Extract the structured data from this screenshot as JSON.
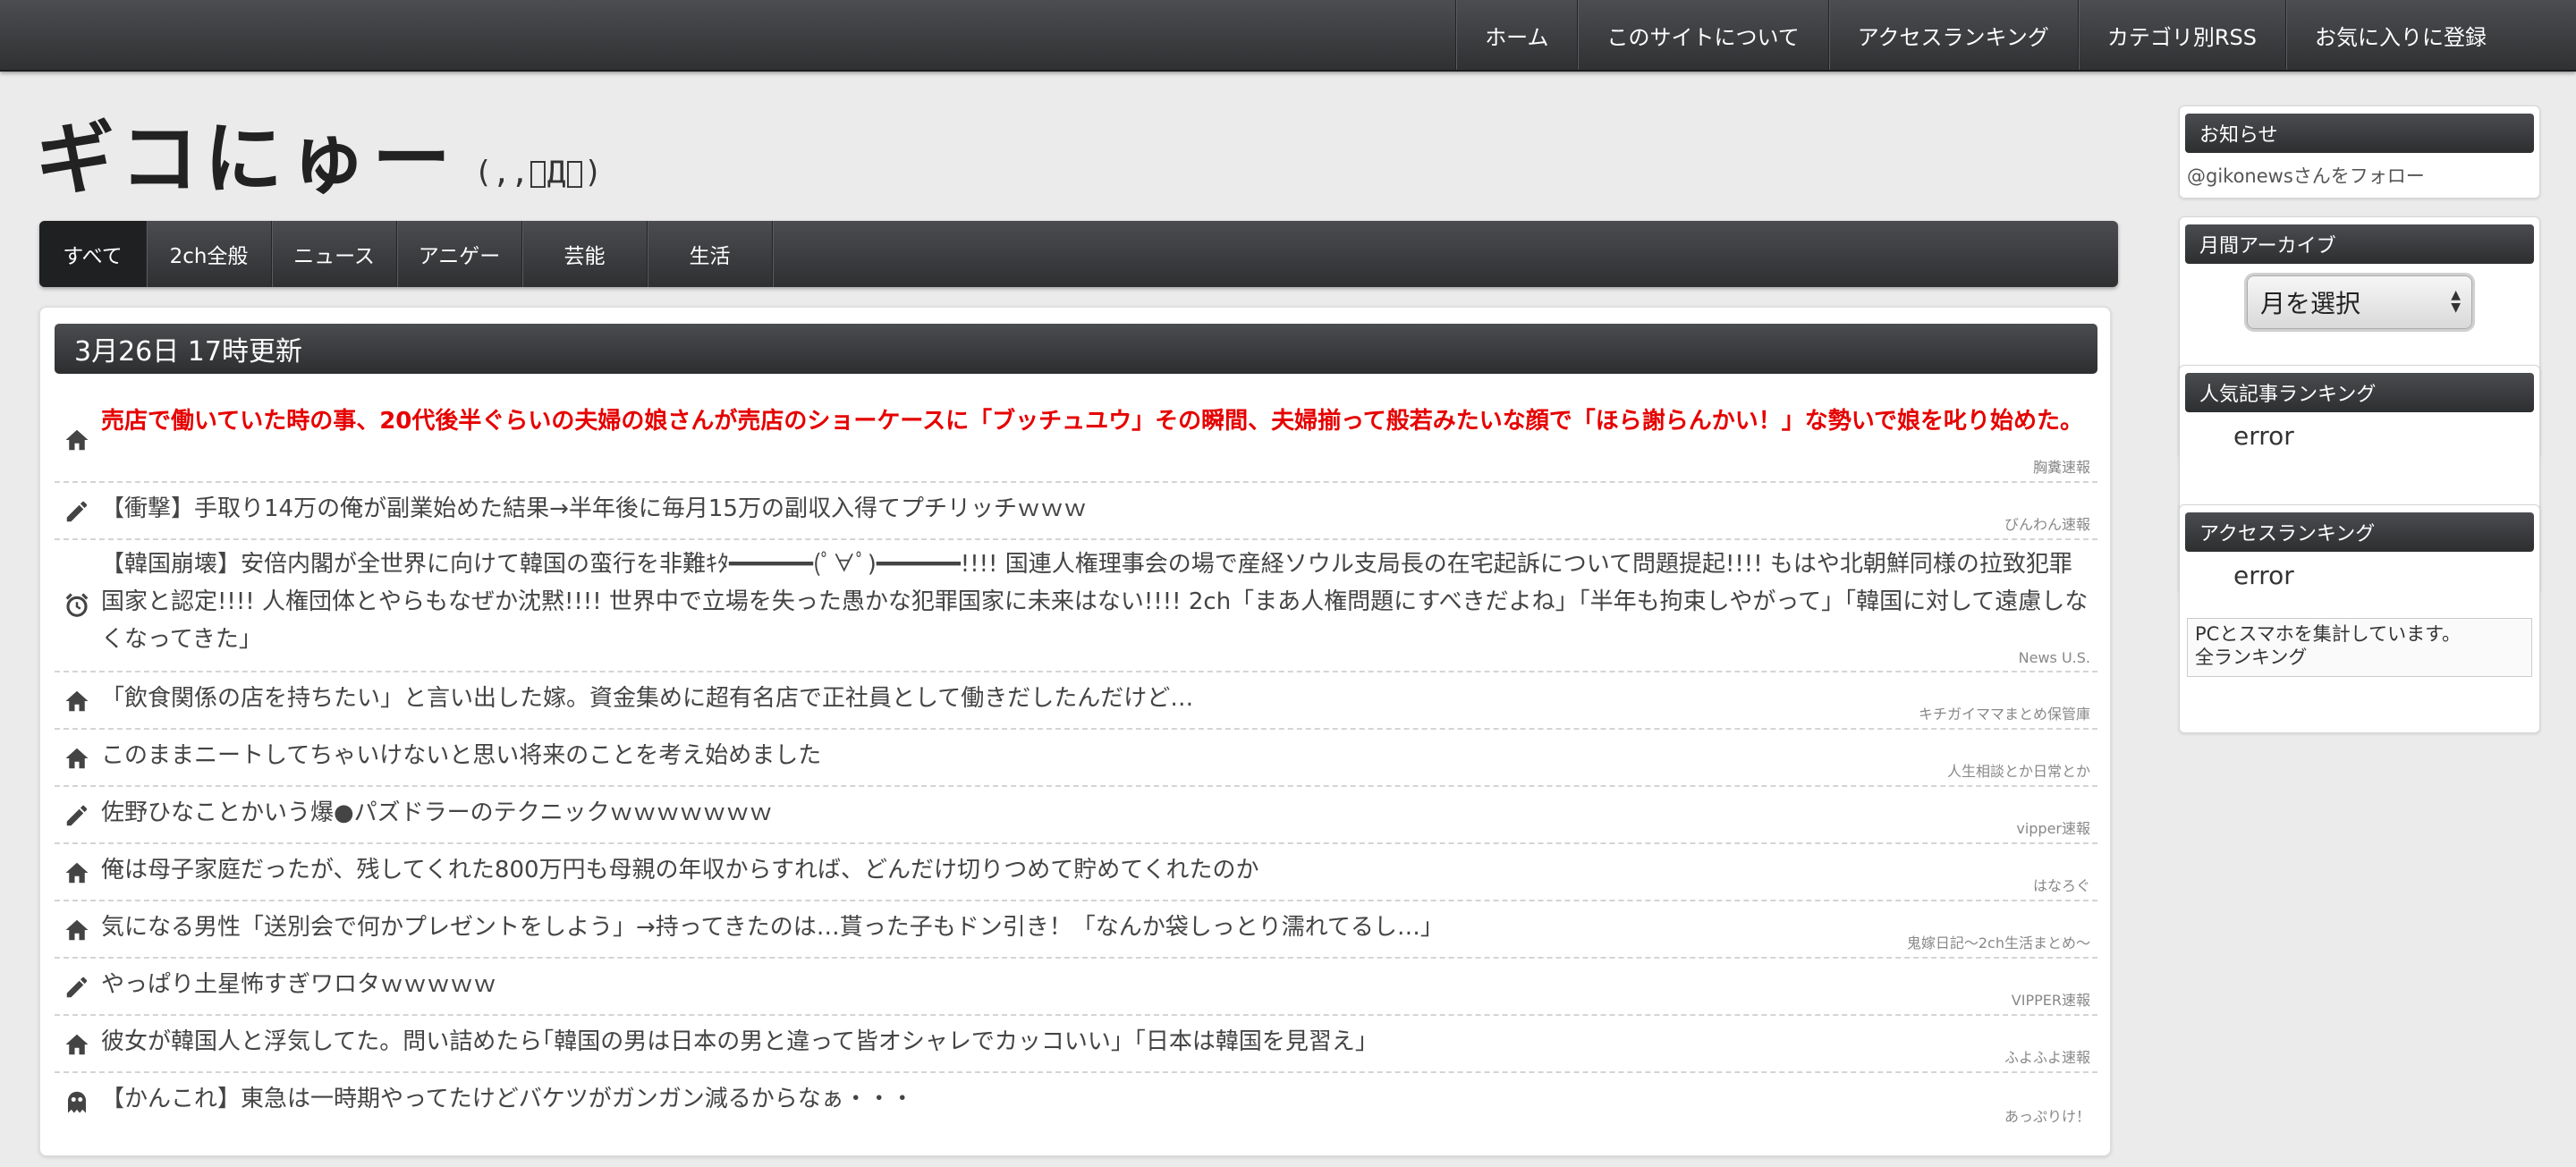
{
  "topnav": {
    "items": [
      "ホーム",
      "このサイトについて",
      "アクセスランキング",
      "カテゴリ別RSS",
      "お気に入りに登録"
    ]
  },
  "logo": {
    "text": "ギコにゅー",
    "face": "(,,゚Д゚)"
  },
  "categories": [
    "すべて",
    "2ch全般",
    "ニュース",
    "アニゲー",
    "芸能",
    "生活"
  ],
  "main": {
    "update_label": "3月26日 17時更新",
    "articles": [
      {
        "icon": "home-icon",
        "title": "売店で働いていた時の事、20代後半ぐらいの夫婦の娘さんが売店のショーケースに「ブッチュユウ」その瞬間、夫婦揃って般若みたいな顔で「ほら謝らんかい！」な勢いで娘を叱り始めた。",
        "source": "胸糞速報",
        "hot": true
      },
      {
        "icon": "pencil-icon",
        "title": "【衝撃】手取り14万の俺が副業始めた結果→半年後に毎月15万の副収入得てプチリッチｗｗｗ",
        "source": "びんわん速報"
      },
      {
        "icon": "alarm-clock-icon",
        "title": "【韓国崩壊】安倍内閣が全世界に向けて韓国の蛮行を非難ｷﾀ━━━━━━(ﾟ∀ﾟ)━━━━━━!!!! 国連人権理事会の場で産経ソウル支局長の在宅起訴について問題提起!!!! もはや北朝鮮同様の拉致犯罪国家と認定!!!! 人権団体とやらもなぜか沈黙!!!! 世界中で立場を失った愚かな犯罪国家に未来はない!!!! 2ch「まあ人権問題にすべきだよね」「半年も拘束しやがって」「韓国に対して遠慮しなくなってきた」",
        "source": "News U.S."
      },
      {
        "icon": "home-icon",
        "title": "「飲食関係の店を持ちたい」と言い出した嫁。資金集めに超有名店で正社員として働きだしたんだけど…",
        "source": "キチガイママまとめ保管庫"
      },
      {
        "icon": "home-icon",
        "title": "このままニートしてちゃいけないと思い将来のことを考え始めました",
        "source": "人生相談とか日常とか"
      },
      {
        "icon": "pencil-icon",
        "title": "佐野ひなことかいう爆●パズドラーのテクニックｗｗｗｗｗｗｗ",
        "source": "vipper速報"
      },
      {
        "icon": "home-icon",
        "title": "俺は母子家庭だったが、残してくれた800万円も母親の年収からすれば、どんだけ切りつめて貯めてくれたのか",
        "source": "はなろぐ"
      },
      {
        "icon": "home-icon",
        "title": "気になる男性「送別会で何かプレゼントをしよう」→持ってきたのは…貰った子もドン引き！「なんか袋しっとり濡れてるし…」",
        "source": "鬼嫁日記〜2ch生活まとめ〜"
      },
      {
        "icon": "pencil-icon",
        "title": "やっぱり土星怖すぎワロタｗｗｗｗｗ",
        "source": "VIPPER速報"
      },
      {
        "icon": "home-icon",
        "title": "彼女が韓国人と浮気してた。問い詰めたら｢韓国の男は日本の男と違って皆オシャレでカッコいい」「日本は韓国を見習え」",
        "source": "ふよふよ速報"
      },
      {
        "icon": "pacman-ghost-icon",
        "title": "【かんこれ】東急は一時期やってたけどバケツがガンガン減るからなぁ・・・",
        "source": "あっぷりけ！"
      }
    ]
  },
  "sidebar": {
    "notice": {
      "title": "お知らせ",
      "follow_text": "@gikonewsさんをフォロー"
    },
    "archive": {
      "title": "月間アーカイブ",
      "select_value": "月を選択"
    },
    "popular": {
      "title": "人気記事ランキング",
      "status": "error"
    },
    "access": {
      "title": "アクセスランキング",
      "status": "error",
      "note_line1": "PCとスマホを集計しています。",
      "note_line2": "全ランキング"
    }
  }
}
